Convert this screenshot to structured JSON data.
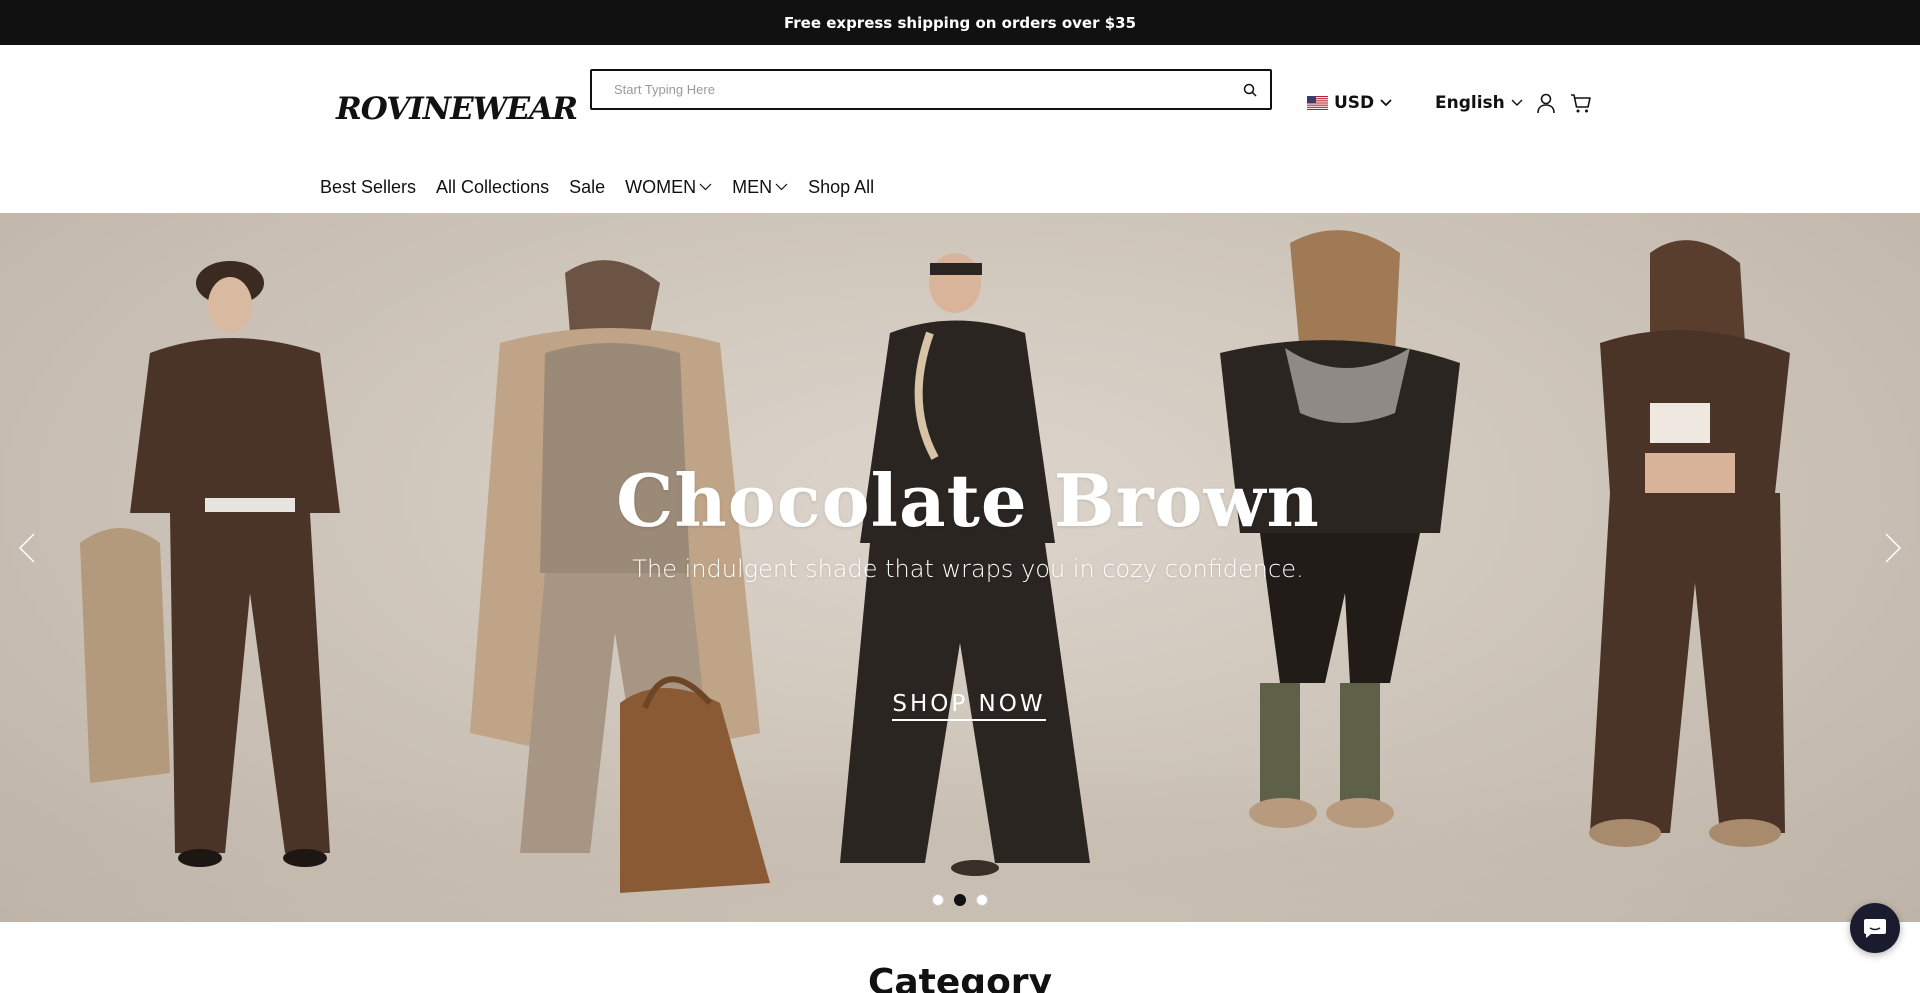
{
  "announcement": {
    "text": "Free express shipping on orders over $35"
  },
  "header": {
    "logo_text": "ROVINEWEAR",
    "search": {
      "placeholder": "Start Typing Here",
      "value": "",
      "icon": "search-icon"
    },
    "currency": {
      "flag": "us-flag-icon",
      "code": "USD"
    },
    "language": {
      "label": "English"
    },
    "icons": {
      "account": "user-icon",
      "cart": "cart-icon"
    }
  },
  "nav": {
    "items": [
      {
        "label": "Best Sellers",
        "has_dropdown": false
      },
      {
        "label": "All Collections",
        "has_dropdown": false
      },
      {
        "label": "Sale",
        "has_dropdown": false
      },
      {
        "label": "WOMEN",
        "has_dropdown": true
      },
      {
        "label": "MEN",
        "has_dropdown": true
      },
      {
        "label": "Shop All",
        "has_dropdown": false
      }
    ]
  },
  "hero": {
    "title": "Chocolate Brown",
    "subtitle": "The indulgent shade that wraps you in cozy confidence.",
    "cta_label": "SHOP NOW",
    "slides_count": 3,
    "active_slide": 2,
    "prev_icon": "chevron-left-icon",
    "next_icon": "chevron-right-icon"
  },
  "category": {
    "heading": "Category"
  },
  "chat": {
    "icon": "chat-icon"
  },
  "colors": {
    "announcement_bg": "#111111",
    "text": "#111111",
    "hero_bg": "#cfc6bb",
    "garment_brown": "#4a3428",
    "garment_tan": "#9b8a77",
    "garment_black": "#2b2522",
    "chat_bg": "#1b1b2f"
  }
}
